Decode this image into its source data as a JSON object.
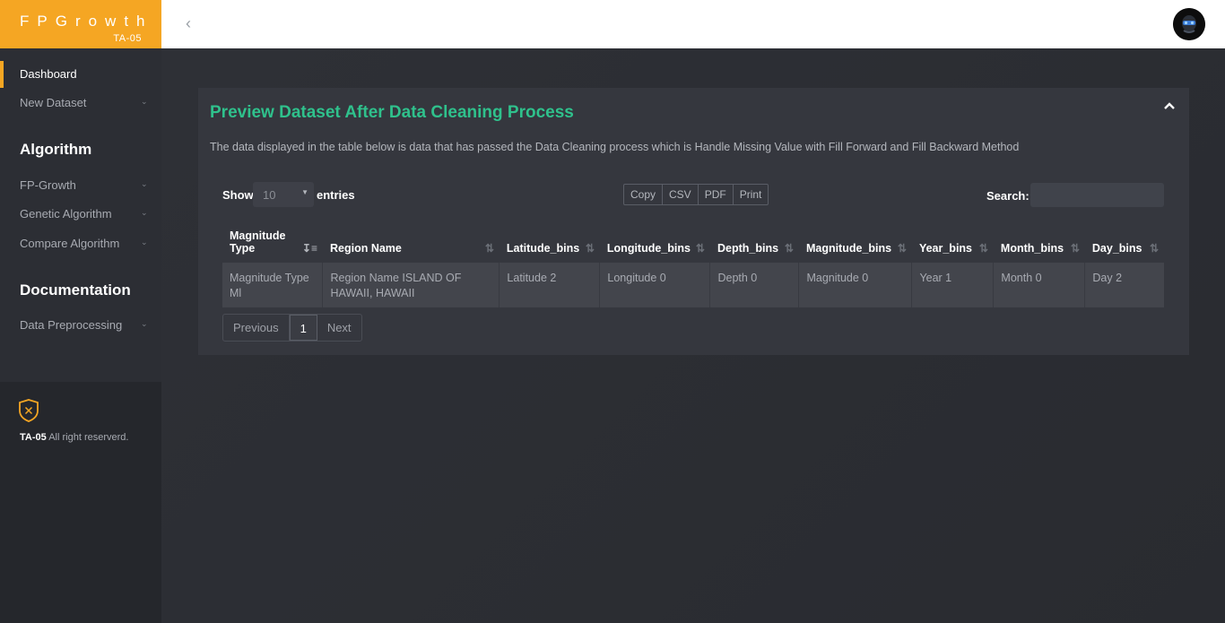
{
  "brand": {
    "title": "FPGrowth",
    "subtitle": "TA-05"
  },
  "header": {
    "collapse_icon": "chevron-left-icon",
    "avatar_icon": "user-avatar-icon"
  },
  "sidebar": {
    "items": [
      {
        "label": "Dashboard",
        "active": true
      },
      {
        "label": "New Dataset",
        "has_submenu": true
      }
    ],
    "algorithm_heading": "Algorithm",
    "algorithm_items": [
      {
        "label": "FP-Growth"
      },
      {
        "label": "Genetic Algorithm"
      },
      {
        "label": "Compare Algorithm"
      }
    ],
    "documentation_heading": "Documentation",
    "documentation_items": [
      {
        "label": "Data Preprocessing"
      }
    ],
    "footer": {
      "brand": "TA-05",
      "text": "All right reserverd."
    }
  },
  "card": {
    "title": "Preview Dataset After Data Cleaning Process",
    "description": "The data displayed in the table below is data that has passed the Data Cleaning process which is Handle Missing Value with Fill Forward and Fill Backward Method",
    "show_label": "Show",
    "show_value": "10",
    "entries_label": "entries",
    "buttons": [
      "Copy",
      "CSV",
      "PDF",
      "Print"
    ],
    "search_label": "Search:",
    "search_value": ""
  },
  "table": {
    "columns": [
      "Magnitude Type",
      "Region Name",
      "Latitude_bins",
      "Longitude_bins",
      "Depth_bins",
      "Magnitude_bins",
      "Year_bins",
      "Month_bins",
      "Day_bins"
    ],
    "rows": [
      [
        "Magnitude Type Ml",
        "Region Name ISLAND OF HAWAII, HAWAII",
        "Latitude 2",
        "Longitude 0",
        "Depth 0",
        "Magnitude 0",
        "Year 1",
        "Month 0",
        "Day 2"
      ]
    ]
  },
  "pagination": {
    "previous": "Previous",
    "current": "1",
    "next": "Next"
  },
  "colors": {
    "brand": "#f5a623",
    "title": "#2fc18c",
    "sidebar": "#2c2e34",
    "panel": "#35373e"
  }
}
